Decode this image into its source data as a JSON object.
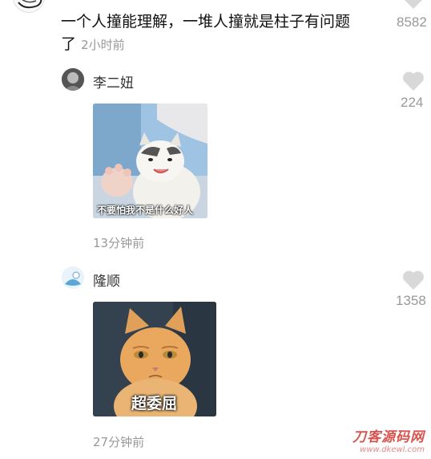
{
  "top_comment": {
    "text_line1": "一个人撞能理解，一堆人撞就是柱子有问题",
    "text_line2": "了",
    "time": "2小时前",
    "like_count": "8582"
  },
  "replies": [
    {
      "name": "李二妞",
      "like_count": "224",
      "sticker_caption": "不要怕我不是什么好人",
      "time": "13分钟前"
    },
    {
      "name": "隆顺",
      "like_count": "1358",
      "sticker_caption": "超委屈",
      "time": "27分钟前"
    }
  ],
  "watermark": {
    "name": "刀客源码网",
    "url": "www.dkewl.com"
  }
}
